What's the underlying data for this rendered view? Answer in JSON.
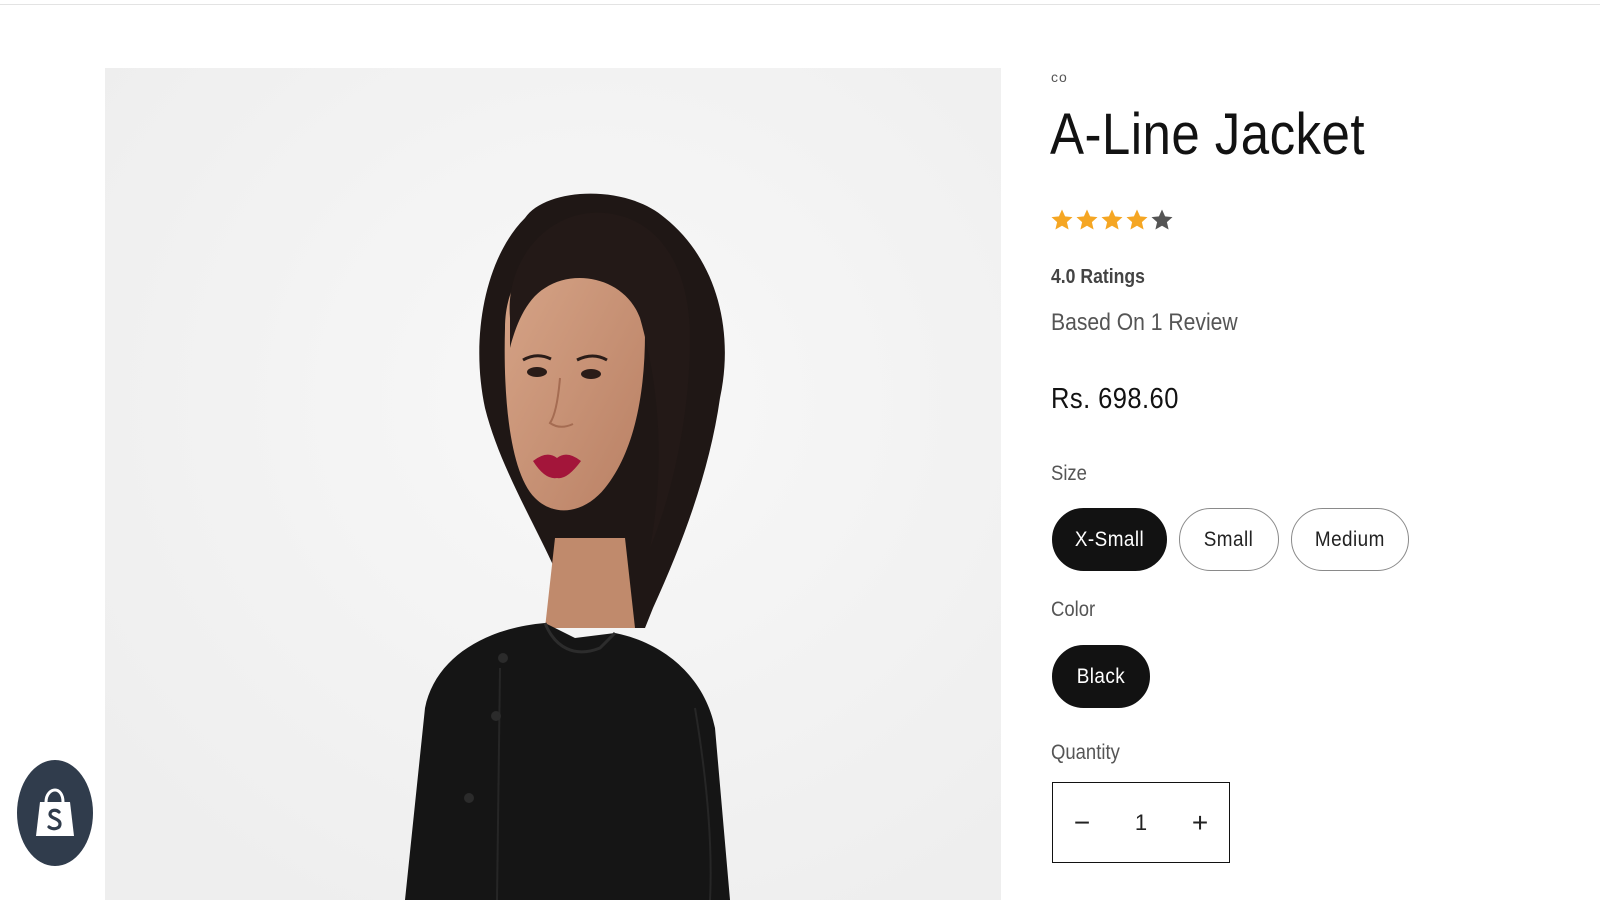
{
  "product": {
    "vendor": "co",
    "title": "A-Line Jacket",
    "rating": {
      "stars_filled": 4,
      "stars_total": 5,
      "label": "4.0 Ratings",
      "reviews_text": "Based On 1 Review",
      "filled_color": "#f5a623",
      "empty_color": "#555555"
    },
    "price": "Rs. 698.60",
    "image_alt": "Woman wearing black A-Line Jacket"
  },
  "options": {
    "size": {
      "label": "Size",
      "values": [
        "X-Small",
        "Small",
        "Medium"
      ],
      "selected": "X-Small"
    },
    "color": {
      "label": "Color",
      "values": [
        "Black"
      ],
      "selected": "Black"
    }
  },
  "quantity": {
    "label": "Quantity",
    "value": "1",
    "decrease_symbol": "−",
    "increase_symbol": "+"
  },
  "widgets": {
    "shopify_icon": "shopify-bag-icon",
    "shopify_color": "#303c4c"
  }
}
